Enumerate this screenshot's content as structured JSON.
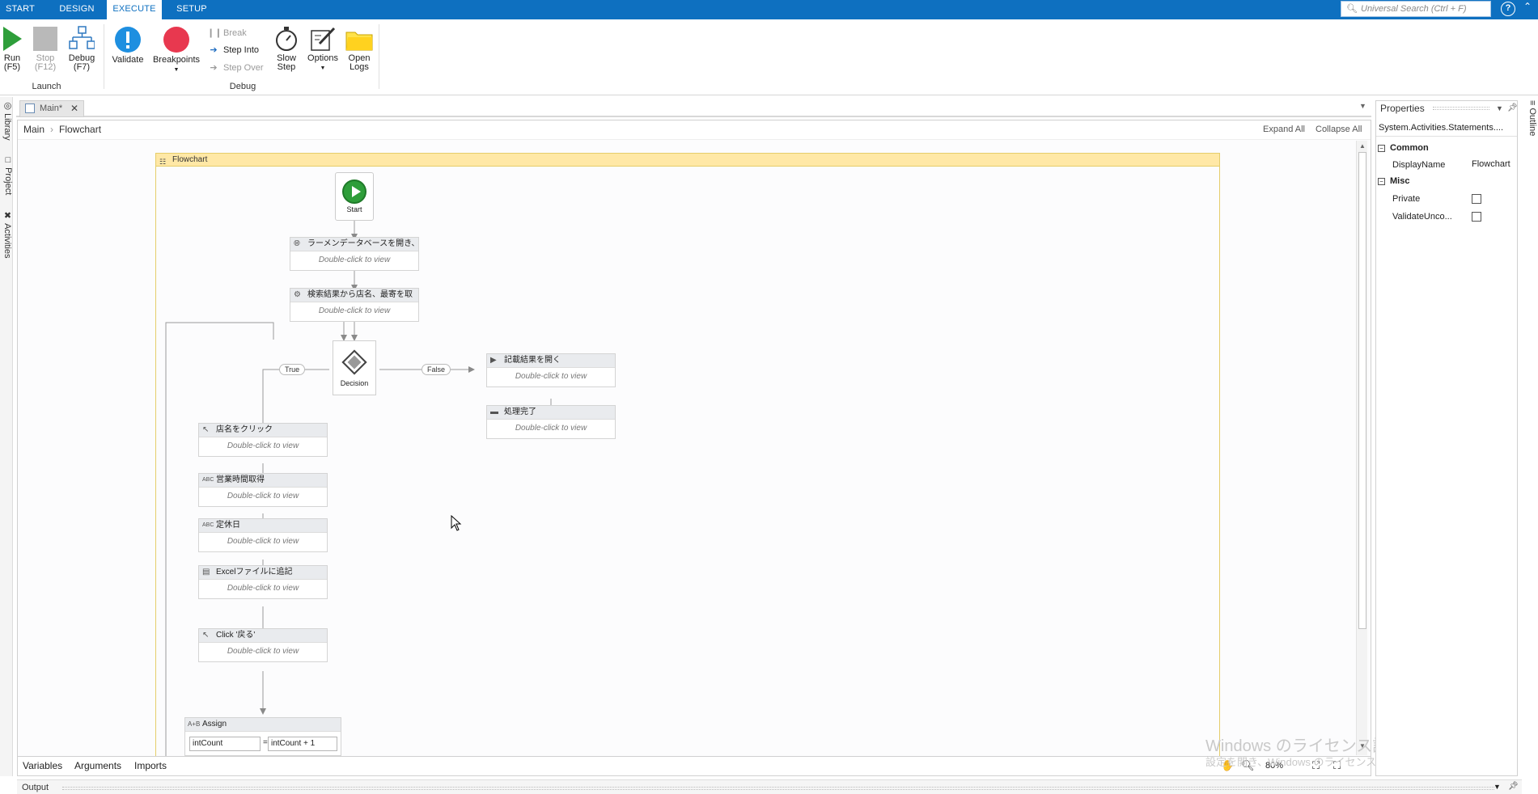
{
  "ribbon_tabs": [
    "START",
    "DESIGN",
    "EXECUTE",
    "SETUP"
  ],
  "active_tab": "EXECUTE",
  "search": {
    "placeholder": "Universal Search (Ctrl + F)"
  },
  "help_label": "?",
  "launch": {
    "run": {
      "label": "Run",
      "key": "(F5)"
    },
    "stop": {
      "label": "Stop",
      "key": "(F12)"
    },
    "debug": {
      "label": "Debug",
      "key": "(F7)"
    },
    "group_label": "Launch"
  },
  "debug_group": {
    "validate": "Validate",
    "breakpoints": "Breakpoints",
    "break": "Break",
    "step_into": "Step Into",
    "step_over": "Step Over",
    "slow_step": {
      "line1": "Slow",
      "line2": "Step"
    },
    "options": "Options",
    "open_logs": {
      "line1": "Open",
      "line2": "Logs"
    },
    "group_label": "Debug"
  },
  "left_panels": [
    "Library",
    "Project",
    "Activities"
  ],
  "right_panels": [
    "Outline"
  ],
  "document_tab": {
    "title": "Main*"
  },
  "breadcrumb": [
    "Main",
    "Flowchart"
  ],
  "expand_all": "Expand All",
  "collapse_all": "Collapse All",
  "flowchart": {
    "title": "Flowchart",
    "start_label": "Start",
    "decision_label": "Decision",
    "true_label": "True",
    "false_label": "False",
    "double_click_hint": "Double-click to view",
    "activities": [
      {
        "title": "ラーメンデータベースを開き、「ラ-"
      },
      {
        "title": "検索結果から店名、最寄を取"
      },
      {
        "title": "記載結果を開く"
      },
      {
        "title": "処理完了"
      },
      {
        "title": "店名をクリック"
      },
      {
        "title": "営業時間取得"
      },
      {
        "title": "定休日"
      },
      {
        "title": "Excelファイルに追記"
      },
      {
        "title": "Click '戻る'"
      }
    ],
    "assign": {
      "title": "Assign",
      "to": "intCount",
      "eq": "=",
      "value": "intCount + 1"
    }
  },
  "bottom_tabs": [
    "Variables",
    "Arguments",
    "Imports"
  ],
  "zoom": "80%",
  "watermark": {
    "line1": "Windows のライセンス認証",
    "line2": "設定を開き、Windows のライセンス認証を行ってください。"
  },
  "output_label": "Output",
  "properties": {
    "title": "Properties",
    "type_name": "System.Activities.Statements....",
    "categories": {
      "common": "Common",
      "misc": "Misc"
    },
    "display_name_label": "DisplayName",
    "display_name_value": "Flowchart",
    "private_label": "Private",
    "validate_label": "ValidateUnco..."
  },
  "colors": {
    "accent": "#0e70c0",
    "run_green": "#2e9e3a",
    "breakpoint_red": "#e8384f",
    "validate_blue": "#1e8fe0",
    "flowchart_header": "#ffe8a6"
  }
}
